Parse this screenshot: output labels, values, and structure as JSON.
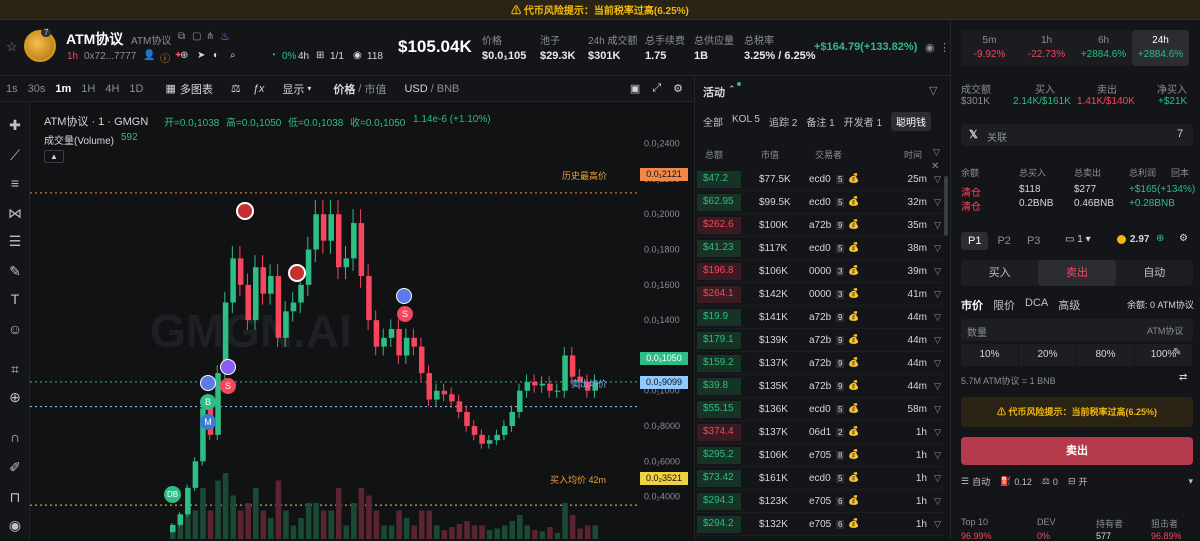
{
  "banner": {
    "text": "⚠ 代币风险提示：当前税率过高(6.25%)"
  },
  "token": {
    "name": "ATM协议",
    "subname": "ATM协议",
    "age": "1h",
    "address": "0x72...7777",
    "holders_pct": "0%",
    "holders_time": "4h",
    "ratio": "1/1",
    "views": "118",
    "market_cap": "$105.04K",
    "badge_num": "7"
  },
  "stats": [
    {
      "label": "价格",
      "value": "$0.0₁105"
    },
    {
      "label": "池子",
      "value": "$29.3K"
    },
    {
      "label": "24h 成交额",
      "value": "$301K"
    },
    {
      "label": "总手续费",
      "value": "1.75"
    },
    {
      "label": "总供应量",
      "value": "1B"
    },
    {
      "label": "总税率",
      "value": "3.25% / 6.25%"
    }
  ],
  "pnl": "+$164.79(+133.82%)",
  "toolbar": {
    "intervals": [
      "1s",
      "30s",
      "1m",
      "1H",
      "4H",
      "1D"
    ],
    "multi": "多图表",
    "display": "显示",
    "price": "价格",
    "mcap": "市值",
    "usd": "USD",
    "bnb": "BNB"
  },
  "chart_info": {
    "title": "ATM协议 · 1 · GMGN",
    "o": "开=0.0₁1038",
    "h": "高=0.0₁1050",
    "l": "低=0.0₁1038",
    "c": "收=0.0₁1050",
    "chg": "1.14e-6 (+1.10%)",
    "vol_label": "成交量(Volume)",
    "vol_val": "592",
    "ath_label": "历史最高价",
    "ath_price": "0.0₁2121",
    "cur_price": "0.0₁1050",
    "sell_avg_label": "卖出均价",
    "sell_avg": "0.0₂9099",
    "buy_avg_label": "买入均价 42m",
    "buy_avg": "0.0₂3521",
    "watermark": "GMGN.AI"
  },
  "chart_data": {
    "type": "candlestick",
    "ylim": [
      1.6e-05,
      0.00025
    ],
    "y_ticks": [
      "0.0₁2400",
      "0.0₁2200",
      "0.0₁2000",
      "0.0₁1800",
      "0.0₁1600",
      "0.0₁1400",
      "0.0₁1200",
      "0.0₁1000",
      "0.0₂8000",
      "0.0₂6000",
      "0.0₂4000"
    ],
    "close": [
      2.4e-05,
      3e-05,
      4.5e-05,
      6e-05,
      9e-05,
      7.5e-05,
      0.00011,
      0.00015,
      0.000175,
      0.00016,
      0.00014,
      0.00017,
      0.000155,
      0.000165,
      0.00013,
      0.000145,
      0.00015,
      0.00016,
      0.00018,
      0.0002,
      0.000185,
      0.0002,
      0.00017,
      0.000175,
      0.000195,
      0.000165,
      0.00014,
      0.000125,
      0.00013,
      0.000135,
      0.00012,
      0.00013,
      0.000125,
      0.00011,
      9.5e-05,
      0.0001,
      9.8e-05,
      9.4e-05,
      8.8e-05,
      8e-05,
      7.5e-05,
      7e-05,
      7.2e-05,
      7.5e-05,
      8e-05,
      8.8e-05,
      0.0001,
      0.000105,
      0.000103,
      0.000104,
      0.0001,
      0.0001,
      0.00012,
      0.000108,
      0.000105,
      0.0001,
      0.000105
    ]
  },
  "activity": {
    "title": "活动",
    "tabs": [
      "全部",
      "KOL 5",
      "追踪 2",
      "备注 1",
      "开发者 1",
      "聪明钱"
    ],
    "cols": [
      "总额",
      "市值",
      "交易者",
      "时间"
    ],
    "rows": [
      {
        "amt": "$47.2",
        "side": "buy",
        "mc": "$77.5K",
        "trader": "ecd0",
        "n": "5",
        "t": "25m"
      },
      {
        "amt": "$62.95",
        "side": "buy",
        "mc": "$99.5K",
        "trader": "ecd0",
        "n": "5",
        "t": "32m"
      },
      {
        "amt": "$262.6",
        "side": "sell",
        "mc": "$100K",
        "trader": "a72b",
        "n": "9",
        "t": "35m"
      },
      {
        "amt": "$41.23",
        "side": "buy",
        "mc": "$117K",
        "trader": "ecd0",
        "n": "5",
        "t": "38m"
      },
      {
        "amt": "$196.8",
        "side": "sell",
        "mc": "$106K",
        "trader": "0000",
        "n": "3",
        "t": "39m"
      },
      {
        "amt": "$264.1",
        "side": "sell",
        "mc": "$142K",
        "trader": "0000",
        "n": "3",
        "t": "41m"
      },
      {
        "amt": "$19.9",
        "side": "buy",
        "mc": "$141K",
        "trader": "a72b",
        "n": "9",
        "t": "44m"
      },
      {
        "amt": "$179.1",
        "side": "buy",
        "mc": "$139K",
        "trader": "a72b",
        "n": "9",
        "t": "44m"
      },
      {
        "amt": "$159.2",
        "side": "buy",
        "mc": "$137K",
        "trader": "a72b",
        "n": "9",
        "t": "44m"
      },
      {
        "amt": "$39.8",
        "side": "buy",
        "mc": "$135K",
        "trader": "a72b",
        "n": "9",
        "t": "44m"
      },
      {
        "amt": "$55.15",
        "side": "buy",
        "mc": "$136K",
        "trader": "ecd0",
        "n": "5",
        "t": "58m"
      },
      {
        "amt": "$374.4",
        "side": "sell",
        "mc": "$137K",
        "trader": "06d1",
        "n": "2",
        "t": "1h"
      },
      {
        "amt": "$295.2",
        "side": "buy",
        "mc": "$106K",
        "trader": "e705",
        "n": "8",
        "t": "1h"
      },
      {
        "amt": "$73.42",
        "side": "buy",
        "mc": "$161K",
        "trader": "ecd0",
        "n": "5",
        "t": "1h"
      },
      {
        "amt": "$294.3",
        "side": "buy",
        "mc": "$123K",
        "trader": "e705",
        "n": "6",
        "t": "1h"
      },
      {
        "amt": "$294.2",
        "side": "buy",
        "mc": "$132K",
        "trader": "e705",
        "n": "6",
        "t": "1h"
      }
    ]
  },
  "right": {
    "timeframes": [
      {
        "label": "5m",
        "val": "-9.92%",
        "side": "neg"
      },
      {
        "label": "1h",
        "val": "-22.73%",
        "side": "neg"
      },
      {
        "label": "6h",
        "val": "+2884.6%",
        "side": "pos"
      },
      {
        "label": "24h",
        "val": "+2884.6%",
        "side": "pos"
      }
    ],
    "vol_label": "成交额",
    "vol_val": "$301K",
    "buy_label": "买入",
    "buy_val": "2.14K/$161K",
    "sell_label": "卖出",
    "sell_val": "1.41K/$140K",
    "net_label": "净买入",
    "net_val": "+$21K",
    "x_label": "关联",
    "x_count": "7",
    "bal_cols": [
      "余额",
      "总买入",
      "总卖出",
      "总利润",
      "回本"
    ],
    "bal_row1": [
      "清仓",
      "$118",
      "$277",
      "+$165(+134%)"
    ],
    "bal_row2": [
      "清仓",
      "0.2BNB",
      "0.46BNB",
      "+0.28BNB"
    ],
    "presets": [
      "P1",
      "P2",
      "P3"
    ],
    "wallet_num": "1",
    "wallet_bal": "2.97",
    "trade_tabs": [
      "买入",
      "卖出",
      "自动"
    ],
    "order_types": [
      "市价",
      "限价",
      "DCA",
      "高级"
    ],
    "balance_txt": "余额: 0 ATM协议",
    "qty_label": "数量",
    "qty_unit": "ATM协议",
    "pcts": [
      "10%",
      "20%",
      "80%",
      "100%"
    ],
    "rate": "5.7M ATM协议 = 1 BNB",
    "warn": "⚠ 代币风险提示：当前税率过高(6.25%)",
    "sell_btn": "卖出",
    "auto": "自动",
    "gas": "0.12",
    "zero": "0",
    "on": "开",
    "bottom_cols": [
      "Top 10",
      "DEV",
      "持有者",
      "狙击者"
    ],
    "bottom_vals": [
      "96.99%",
      "0%",
      "577",
      "96.89%"
    ]
  }
}
